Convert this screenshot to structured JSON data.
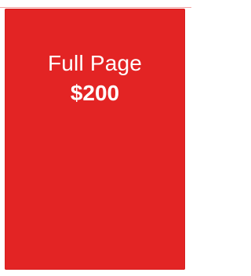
{
  "ad_option": {
    "title": "Full Page",
    "price": "$200",
    "background_color": "#e32424",
    "text_color": "#ffffff"
  }
}
